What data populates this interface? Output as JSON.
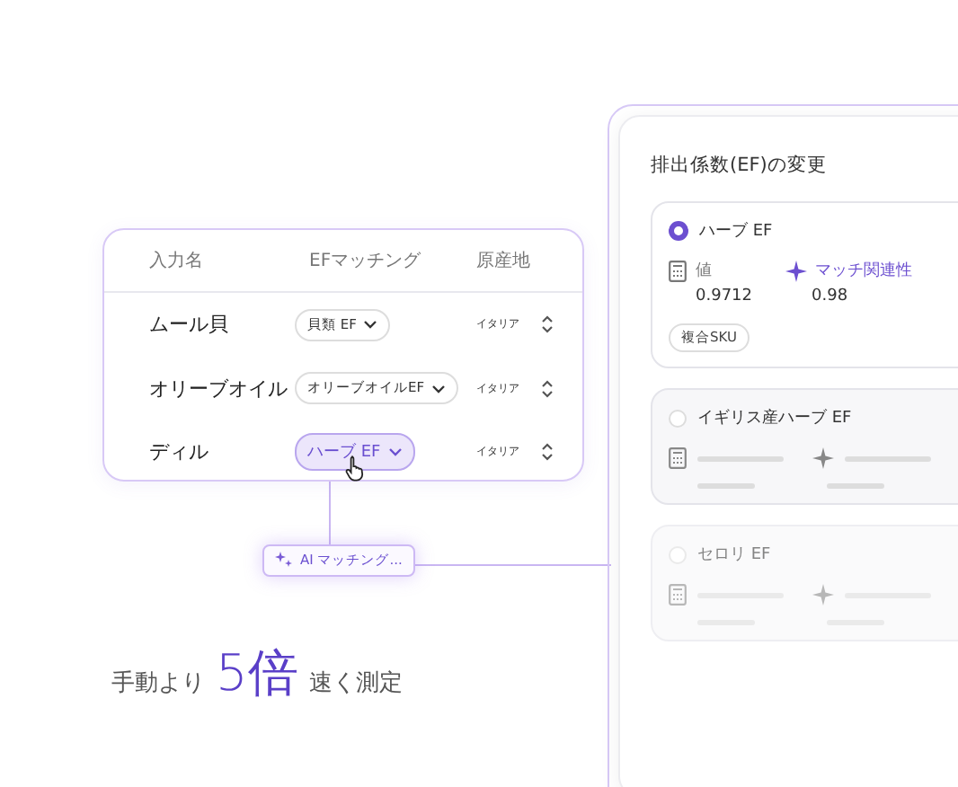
{
  "table": {
    "columns": [
      "入力名",
      "EFマッチング",
      "原産地"
    ],
    "rows": [
      {
        "name": "ムール貝",
        "match": "貝類 EF",
        "origin": "イタリア",
        "selected": false
      },
      {
        "name": "オリーブオイル",
        "match": "オリーブオイルEF",
        "origin": "イタリア",
        "selected": false
      },
      {
        "name": "ディル",
        "match": "ハーブ EF",
        "origin": "イタリア",
        "selected": true
      }
    ]
  },
  "ai_chip": {
    "label": "AI マッチング..."
  },
  "headline": {
    "before": "手動より",
    "highlight": "5倍",
    "after": "速く測定"
  },
  "panel": {
    "title": "排出係数(EF)の変更",
    "options": [
      {
        "kind": "detail",
        "label": "ハーブ EF",
        "selected": true,
        "value_label": "値",
        "value": "0.9712",
        "relevance_label": "マッチ関連性",
        "relevance": "0.98",
        "tag": "複合SKU"
      },
      {
        "kind": "skeleton",
        "label": "イギリス産ハーブ EF",
        "selected": false
      },
      {
        "kind": "skeleton",
        "label": "セロリ EF",
        "selected": false
      }
    ]
  }
}
